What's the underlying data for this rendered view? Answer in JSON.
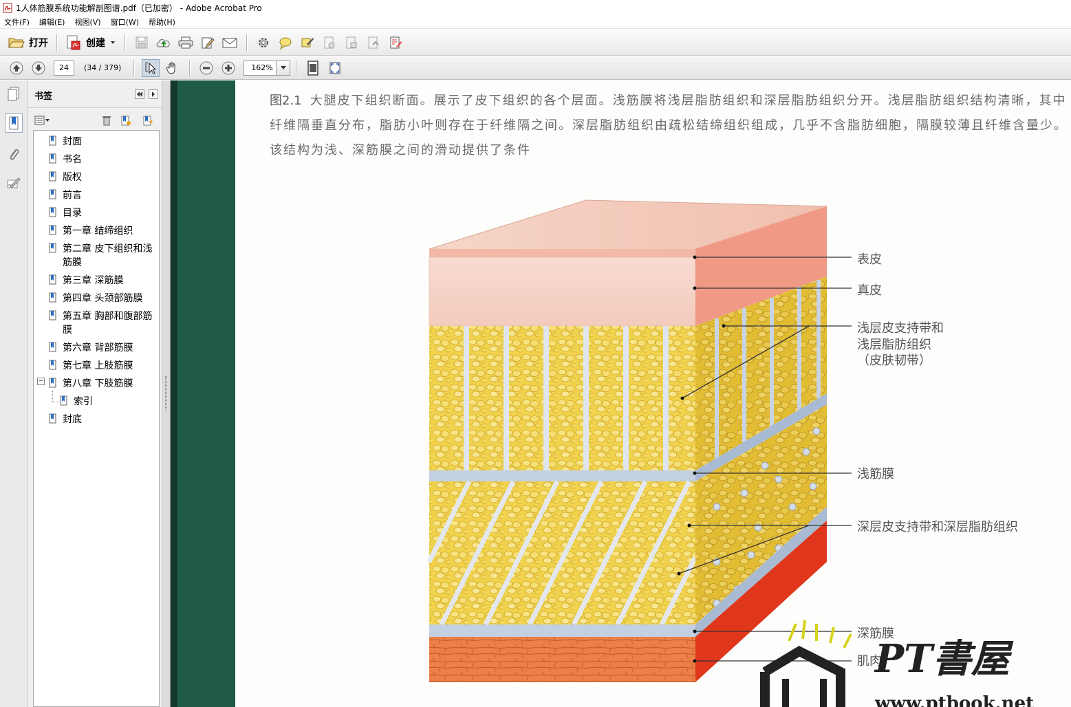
{
  "window": {
    "title": "1人体筋膜系统功能解剖图谱.pdf（已加密） - Adobe Acrobat Pro"
  },
  "menu": [
    {
      "label": "文件(F)"
    },
    {
      "label": "编辑(E)"
    },
    {
      "label": "视图(V)"
    },
    {
      "label": "窗口(W)"
    },
    {
      "label": "帮助(H)"
    }
  ],
  "toolbar": {
    "open_label": "打开",
    "create_label": "创建"
  },
  "nav": {
    "page_number": "24",
    "page_count": "(34 / 379)",
    "zoom": "162%"
  },
  "bookmarks": {
    "title": "书签",
    "items": [
      {
        "label": "封面"
      },
      {
        "label": "书名"
      },
      {
        "label": "版权"
      },
      {
        "label": "前言"
      },
      {
        "label": "目录"
      },
      {
        "label": "第一章  结缔组织"
      },
      {
        "label": "第二章  皮下组织和浅筋膜"
      },
      {
        "label": "第三章  深筋膜"
      },
      {
        "label": "第四章  头颈部筋膜"
      },
      {
        "label": "第五章  胸部和腹部筋膜"
      },
      {
        "label": "第六章  背部筋膜"
      },
      {
        "label": "第七章  上肢筋膜"
      },
      {
        "label": "第八章  下肢筋膜"
      },
      {
        "label": "索引"
      },
      {
        "label": "封底"
      }
    ]
  },
  "document": {
    "figure_number": "图2.1",
    "caption": "大腿皮下组织断面。展示了皮下组织的各个层面。浅筋膜将浅层脂肪组织和深层脂肪组织分开。浅层脂肪组织结构清晰，其中纤维隔垂直分布，脂肪小叶则存在于纤维隔之间。深层脂肪组织由疏松结缔组织组成，几乎不含脂肪细胞，隔膜较薄且纤维含量少。该结构为浅、深筋膜之间的滑动提供了条件",
    "labels": {
      "epidermis": "表皮",
      "dermis": "真皮",
      "superficial_line1": "浅层皮支持带和",
      "superficial_line2": "浅层脂肪组织",
      "superficial_line3": "（皮肤韧带）",
      "superficial_fascia": "浅筋膜",
      "deep_retinaculum": "深层皮支持带和深层脂肪组织",
      "deep_fascia": "深筋膜",
      "muscle": "肌肉"
    },
    "watermark": {
      "brand": "PT書屋",
      "url": "www.ptbook.net"
    }
  },
  "colors": {
    "spine": "#1f5b47",
    "skin": "#f2c9bc",
    "fat": "#f0d24a",
    "fascia": "#b8c8dc",
    "muscle": "#e8713f"
  }
}
